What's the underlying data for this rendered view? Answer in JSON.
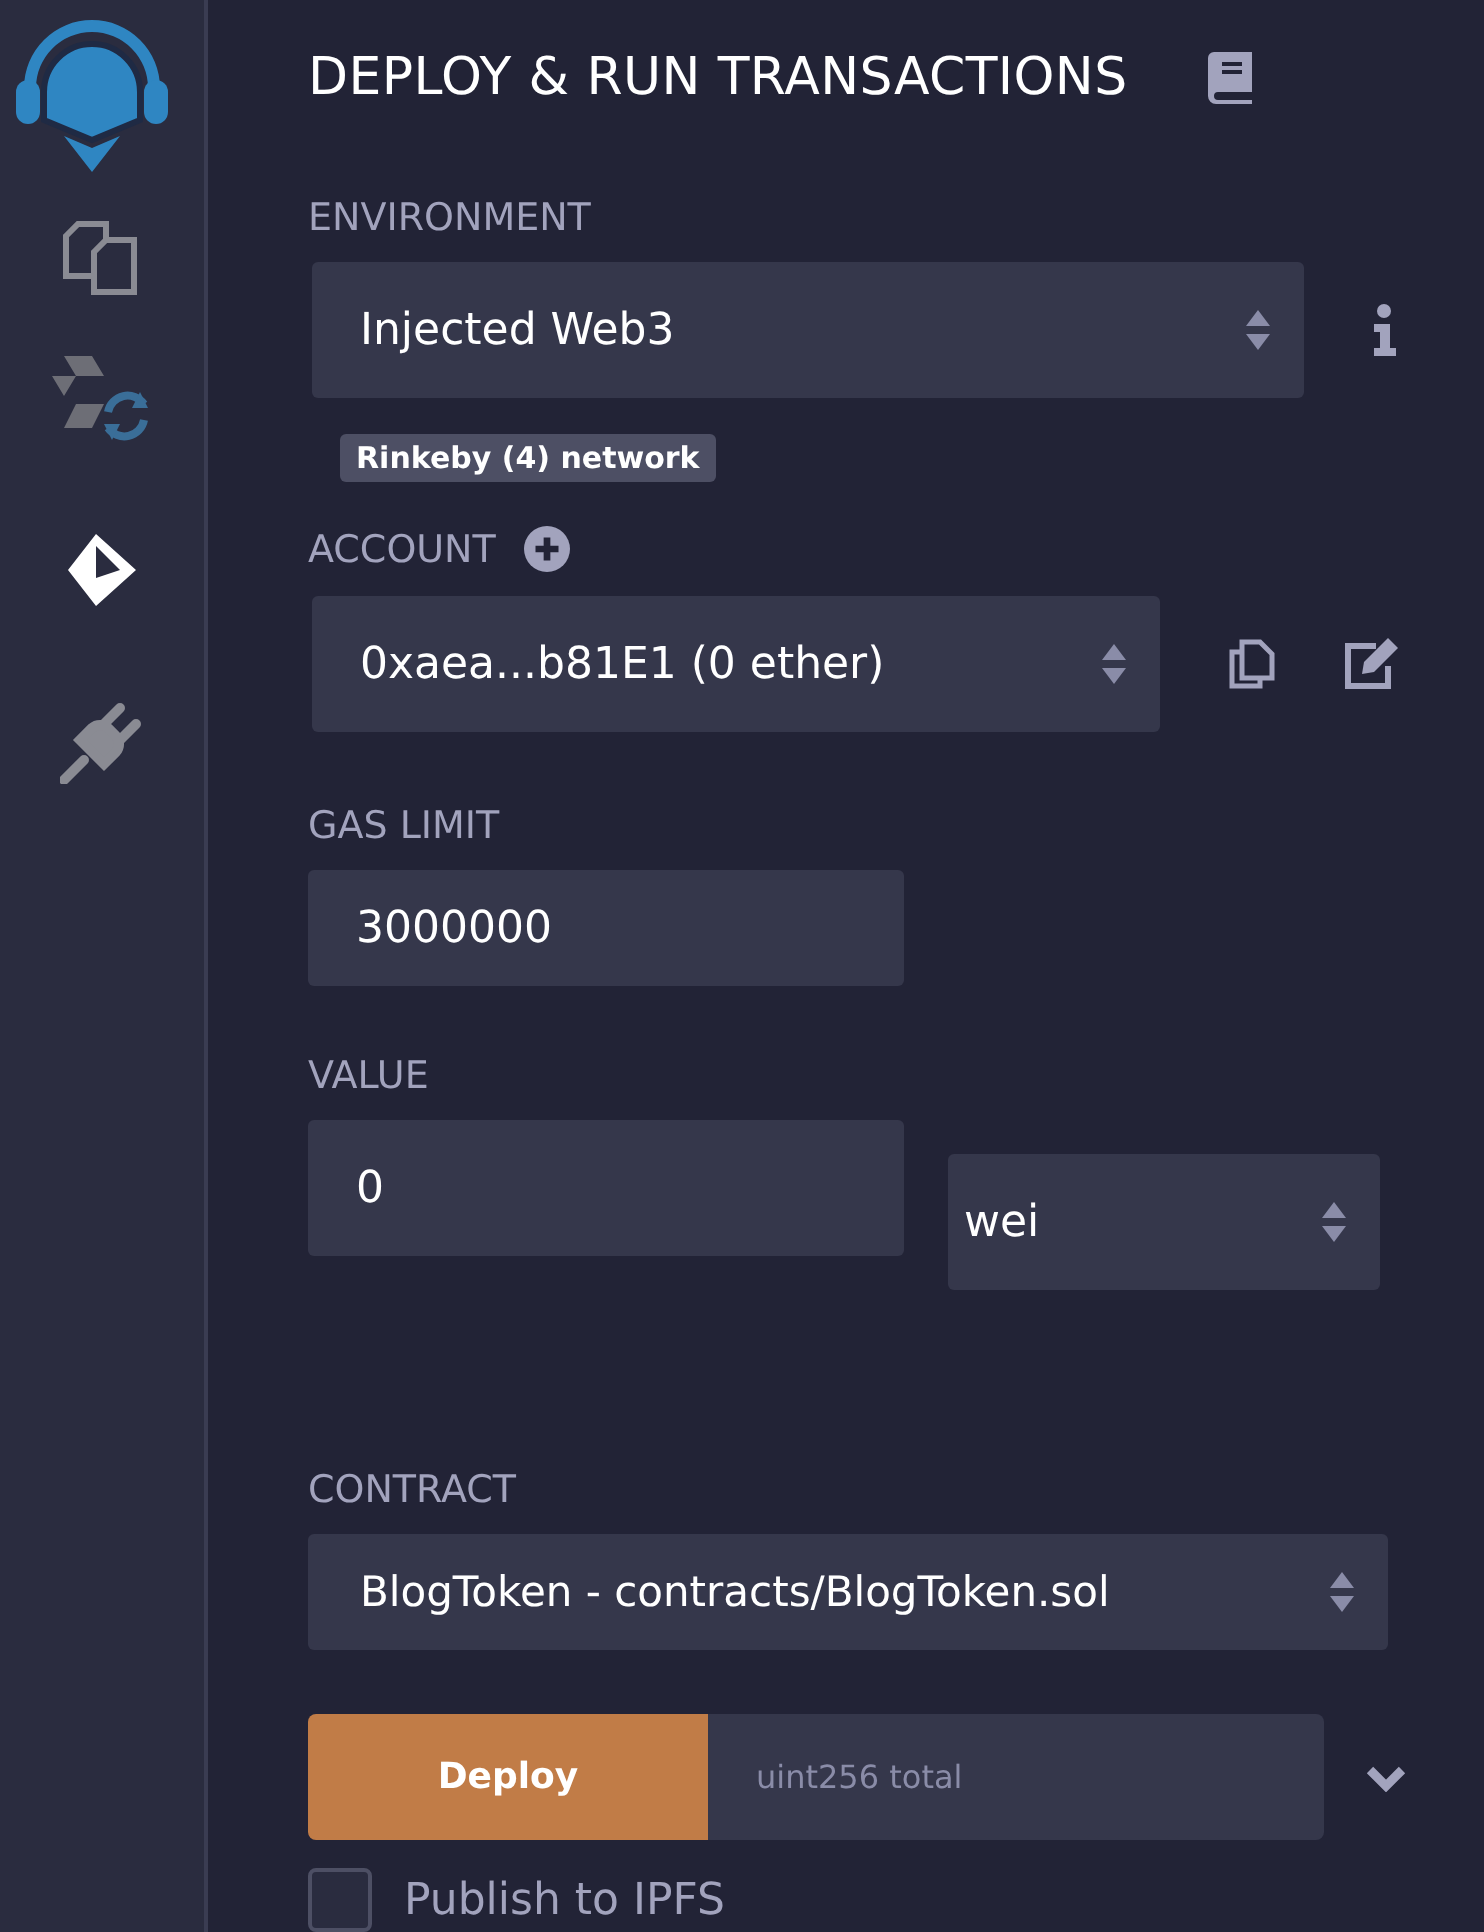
{
  "sidebar": {
    "items": [
      {
        "kind": "logo",
        "selected": false
      },
      {
        "kind": "files",
        "selected": false
      },
      {
        "kind": "compiler",
        "selected": false
      },
      {
        "kind": "deploy",
        "selected": true
      },
      {
        "kind": "plugins",
        "selected": false
      }
    ]
  },
  "title": "DEPLOY & RUN TRANSACTIONS",
  "environment": {
    "label": "ENVIRONMENT",
    "value": "Injected Web3",
    "network_badge": "Rinkeby (4) network"
  },
  "account": {
    "label": "ACCOUNT",
    "value": "0xaea...b81E1 (0 ether)"
  },
  "gas_limit": {
    "label": "GAS LIMIT",
    "value": "3000000"
  },
  "value": {
    "label": "VALUE",
    "amount": "0",
    "unit": "wei"
  },
  "contract": {
    "label": "CONTRACT",
    "value": "BlogToken - contracts/BlogToken.sol"
  },
  "deploy": {
    "button": "Deploy",
    "placeholder": "uint256 total"
  },
  "publish": {
    "label": "Publish to IPFS",
    "checked": false
  }
}
